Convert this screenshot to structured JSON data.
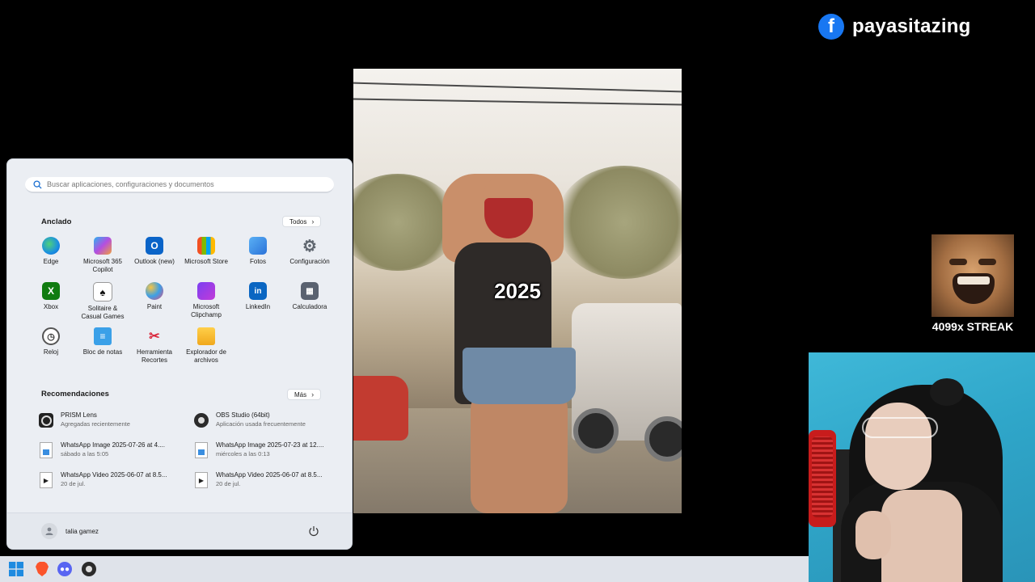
{
  "facebook": {
    "name": "payasitazing",
    "icon": "facebook-icon"
  },
  "video": {
    "caption": "2025"
  },
  "streak": {
    "text": "4099x STREAK"
  },
  "start_menu": {
    "search_placeholder": "Buscar aplicaciones, configuraciones y documentos",
    "pinned_title": "Anclado",
    "all_button": "Todos",
    "pinned_apps": [
      {
        "label": "Edge",
        "icon": "edge-icon"
      },
      {
        "label": "Microsoft 365\nCopilot",
        "icon": "m365-copilot-icon"
      },
      {
        "label": "Outlook (new)",
        "icon": "outlook-icon"
      },
      {
        "label": "Microsoft Store",
        "icon": "store-icon"
      },
      {
        "label": "Fotos",
        "icon": "photos-icon"
      },
      {
        "label": "Configuración",
        "icon": "settings-gear-icon"
      },
      {
        "label": "Xbox",
        "icon": "xbox-icon"
      },
      {
        "label": "Solitaire &\nCasual Games",
        "icon": "solitaire-icon"
      },
      {
        "label": "Paint",
        "icon": "paint-icon"
      },
      {
        "label": "Microsoft\nClipchamp",
        "icon": "clipchamp-icon"
      },
      {
        "label": "LinkedIn",
        "icon": "linkedin-icon"
      },
      {
        "label": "Calculadora",
        "icon": "calculator-icon"
      },
      {
        "label": "Reloj",
        "icon": "clock-icon"
      },
      {
        "label": "Bloc de notas",
        "icon": "notepad-icon"
      },
      {
        "label": "Herramienta\nRecortes",
        "icon": "snipping-tool-icon"
      },
      {
        "label": "Explorador de\narchivos",
        "icon": "file-explorer-icon"
      }
    ],
    "recommended_title": "Recomendaciones",
    "more_button": "Más",
    "recommendations": [
      {
        "name": "PRISM Lens",
        "sub": "Agregadas recientemente",
        "icon": "prism-lens-icon"
      },
      {
        "name": "OBS Studio (64bit)",
        "sub": "Aplicación usada frecuentemente",
        "icon": "obs-icon"
      },
      {
        "name": "WhatsApp Image 2025-07-26 at 4....",
        "sub": "sábado a las 5:05",
        "icon": "image-file-icon"
      },
      {
        "name": "WhatsApp Image 2025-07-23 at 12....",
        "sub": "miércoles a las 0:13",
        "icon": "image-file-icon"
      },
      {
        "name": "WhatsApp Video 2025-06-07 at 8.5...",
        "sub": "20 de jul.",
        "icon": "video-file-icon"
      },
      {
        "name": "WhatsApp Video 2025-06-07 at 8.5...",
        "sub": "20 de jul.",
        "icon": "video-file-icon"
      }
    ],
    "user_name": "talia gamez"
  },
  "taskbar": {
    "items": [
      "windows-start-icon",
      "brave-icon",
      "discord-icon",
      "obs-icon"
    ]
  },
  "colors": {
    "facebook": "#1877f2",
    "start_bg": "#ebeef3",
    "taskbar_bg": "#dfe3ea"
  }
}
